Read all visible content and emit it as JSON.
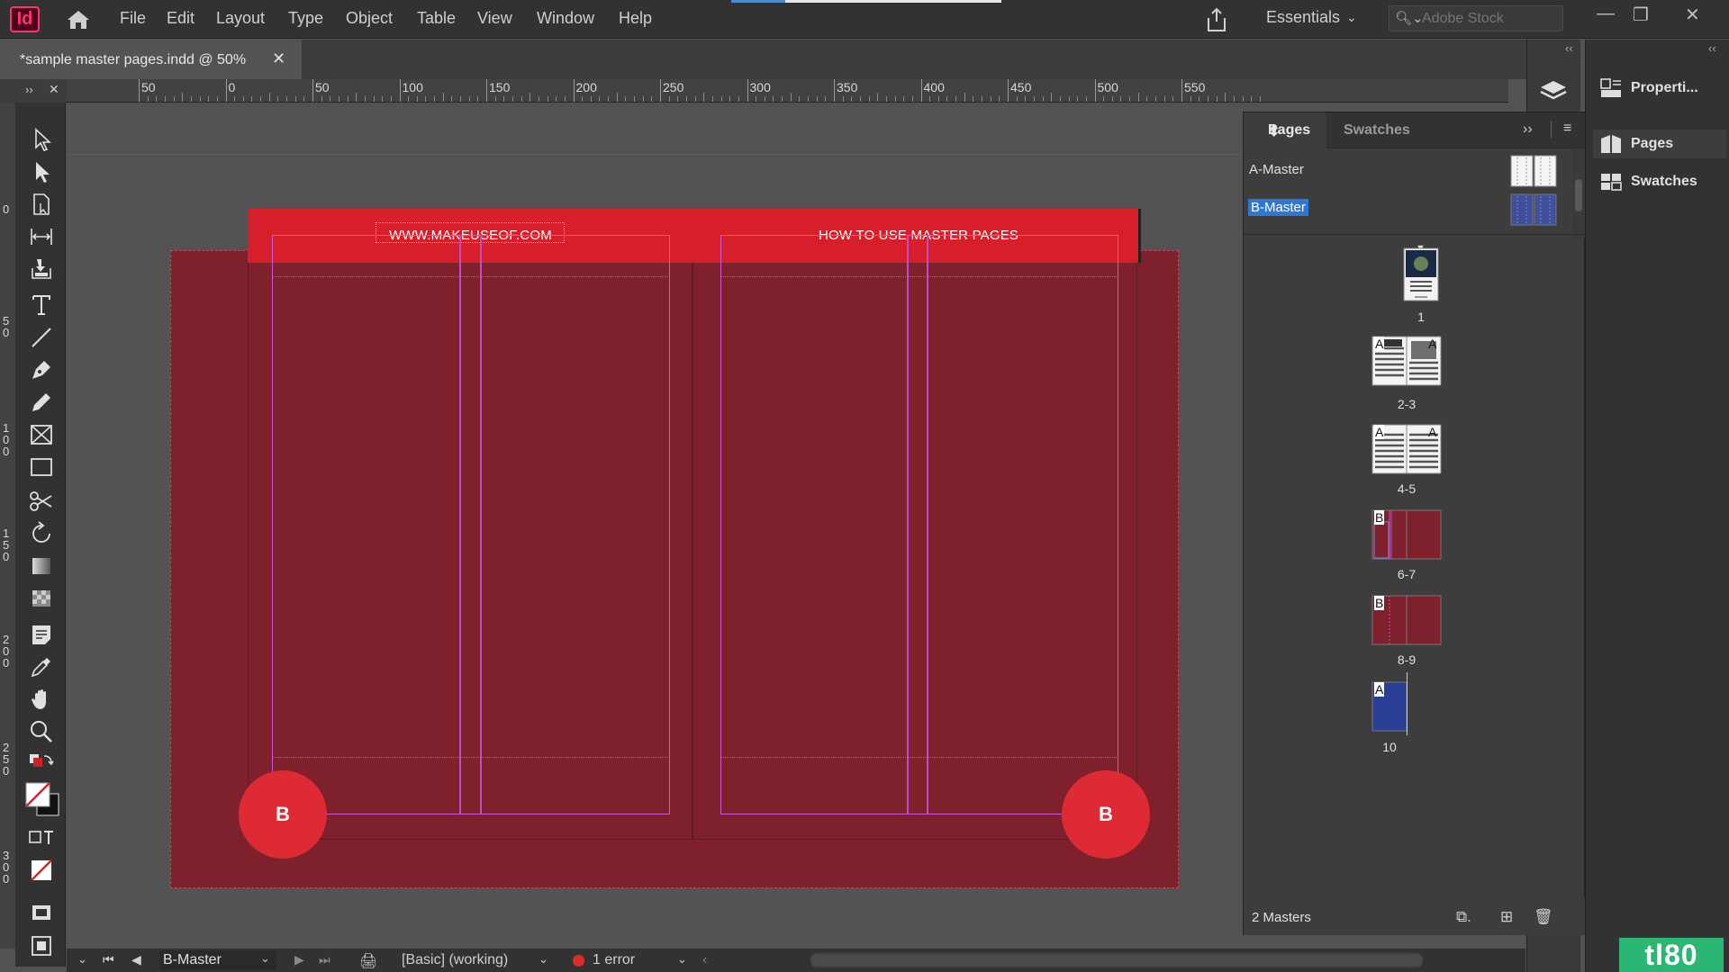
{
  "app": {
    "logo": "Id",
    "window_controls": [
      "—",
      "❐",
      "✕"
    ]
  },
  "menu": [
    "File",
    "Edit",
    "Layout",
    "Type",
    "Object",
    "Table",
    "View",
    "Window",
    "Help"
  ],
  "workspace": "Essentials",
  "search": {
    "placeholder": "Adobe Stock"
  },
  "document_tab": {
    "title": "*sample master pages.indd @ 50%",
    "close": "✕"
  },
  "ruler": {
    "labels": [
      "50",
      "0",
      "50",
      "100",
      "150",
      "200",
      "250",
      "300",
      "350",
      "400",
      "450",
      "500",
      "550"
    ],
    "vertical_labels": [
      "0",
      "5\n0",
      "1\n0\n0",
      "1\n5\n0",
      "2\n0\n0",
      "2\n5\n0",
      "3\n0\n0"
    ]
  },
  "spread": {
    "left_header": "WWW.MAKEUSEOF.COM",
    "right_header": "HOW TO USE MASTER PAGES",
    "left_marker": "B",
    "right_marker": "B",
    "fill_color": "#7e212d",
    "header_color": "#d71f2b"
  },
  "status": {
    "page_select": "B-Master",
    "style": "[Basic] (working)",
    "errors": "1 error"
  },
  "pages_panel": {
    "tabs": [
      "Pages",
      "Swatches"
    ],
    "masters": [
      {
        "label": "A-Master",
        "selected": false
      },
      {
        "label": "B-Master",
        "selected": true
      }
    ],
    "pages": [
      {
        "label": "1",
        "master": ""
      },
      {
        "label": "2-3",
        "master": "A"
      },
      {
        "label": "4-5",
        "master": "A"
      },
      {
        "label": "6-7",
        "master": "B"
      },
      {
        "label": "8-9",
        "master": "B"
      },
      {
        "label": "10",
        "master": "A"
      }
    ],
    "footer": "2 Masters"
  },
  "dock": {
    "items": [
      "Properti...",
      "Pages",
      "Swatches"
    ]
  },
  "watermark": "tl80"
}
